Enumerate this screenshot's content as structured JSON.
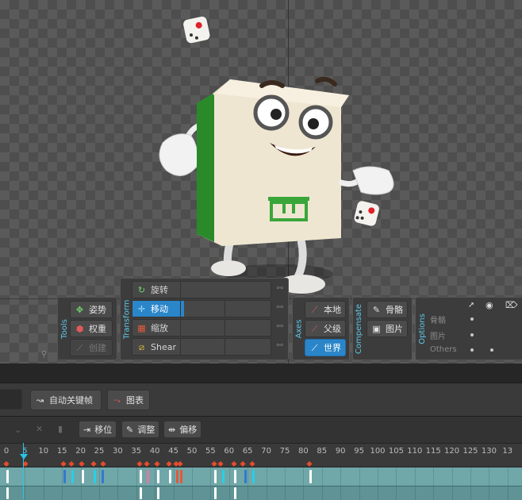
{
  "tools": {
    "title": "Tools",
    "pose": "姿势",
    "weight": "权重",
    "create": "创建"
  },
  "transform": {
    "title": "Transform",
    "rotate": "旋转",
    "translate": "移动",
    "scale": "缩放",
    "shear": "Shear"
  },
  "axes": {
    "title": "Axes",
    "local": "本地",
    "parent": "父级",
    "world": "世界"
  },
  "compensate": {
    "title": "Compensate",
    "bones": "骨骼",
    "images": "图片"
  },
  "options": {
    "title": "Options",
    "rows": [
      "骨骼",
      "图片",
      "Others"
    ]
  },
  "toolbar1": {
    "autokey": "自动关键帧",
    "graph": "图表"
  },
  "toolbar2": {
    "offset_pos": "移位",
    "adjust": "调整",
    "shift": "偏移"
  },
  "ruler": {
    "ticks": [
      "0",
      "5",
      "10",
      "15",
      "20",
      "25",
      "30",
      "35",
      "40",
      "45",
      "50",
      "55",
      "60",
      "65",
      "70",
      "75",
      "80",
      "85",
      "90",
      "95",
      "100",
      "105",
      "110",
      "115",
      "120",
      "125",
      "130",
      "13"
    ]
  },
  "colors": {
    "accent": "#2a86c9",
    "label": "#5ec6e8",
    "keyframe": "#e74c2c",
    "track": "#70a7a9",
    "playhead": "#28c4e6"
  }
}
